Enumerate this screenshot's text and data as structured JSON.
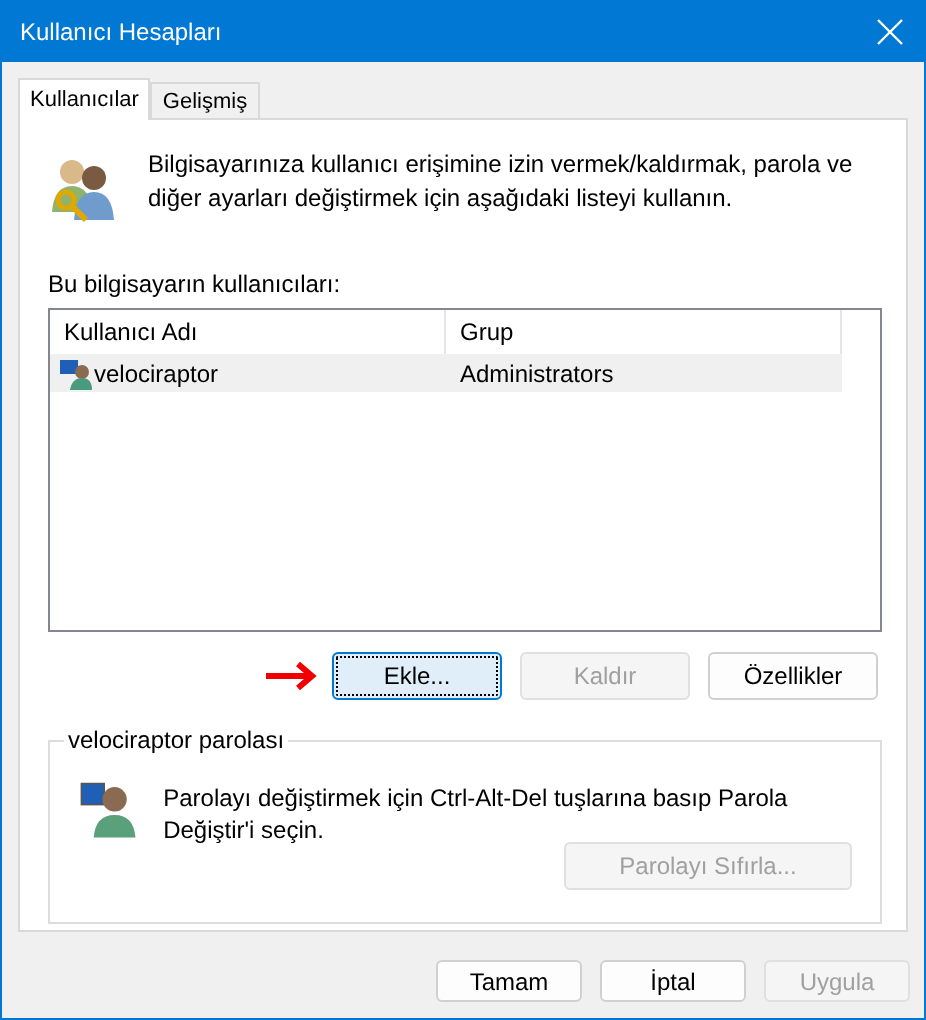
{
  "window": {
    "title": "Kullanıcı Hesapları"
  },
  "tabs": [
    {
      "label": "Kullanıcılar",
      "selected": true
    },
    {
      "label": "Gelişmiş",
      "selected": false
    }
  ],
  "intro": "Bilgisayarınıza kullanıcı erişimine izin vermek/kaldırmak, parola ve diğer ayarları değiştirmek için aşağıdaki listeyi kullanın.",
  "users_label": "Bu bilgisayarın kullanıcıları:",
  "table": {
    "columns": [
      "Kullanıcı Adı",
      "Grup"
    ],
    "rows": [
      {
        "cells": [
          "velociraptor",
          "Administrators"
        ],
        "selected": true
      }
    ]
  },
  "list_buttons": [
    {
      "label": "Ekle...",
      "disabled": false,
      "focused": true
    },
    {
      "label": "Kaldır",
      "disabled": true,
      "focused": false
    },
    {
      "label": "Özellikler",
      "disabled": false,
      "focused": false
    }
  ],
  "password_group": {
    "title": "velociraptor parolası",
    "text": "Parolayı değiştirmek için Ctrl-Alt-Del tuşlarına basıp Parola Değiştir'i seçin.",
    "button": {
      "label": "Parolayı Sıfırla...",
      "disabled": true
    }
  },
  "dialog_buttons": [
    {
      "label": "Tamam",
      "disabled": false
    },
    {
      "label": "İptal",
      "disabled": false
    },
    {
      "label": "Uygula",
      "disabled": true
    }
  ]
}
